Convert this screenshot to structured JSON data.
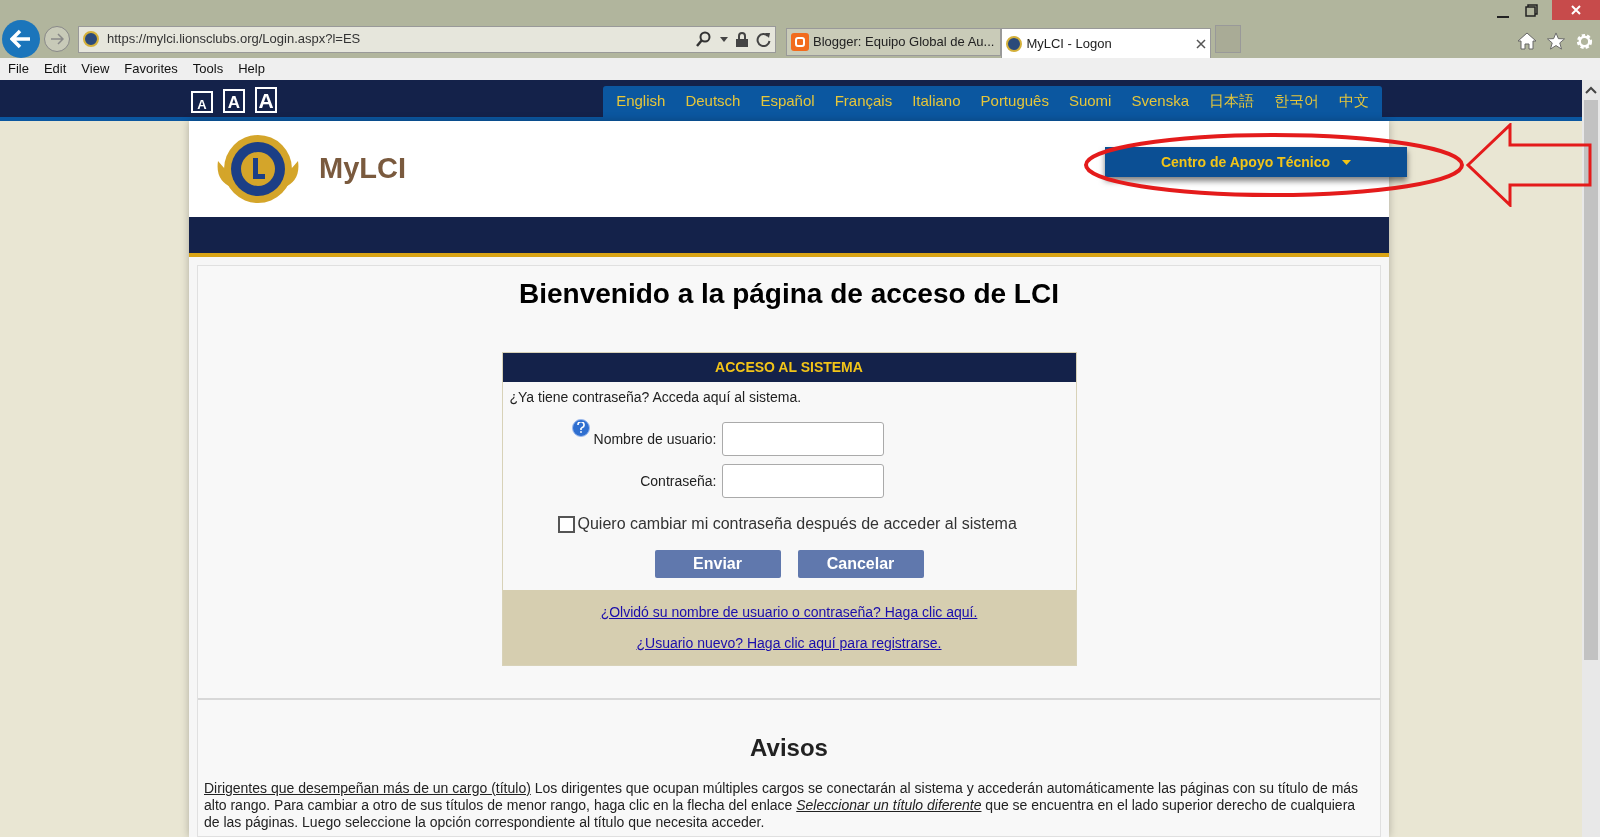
{
  "browser": {
    "address": "https://mylci.lionsclubs.org/Login.aspx?l=ES",
    "tabs": [
      {
        "label": "Blogger: Equipo Global de Au...",
        "selected": false,
        "kind": "blogger"
      },
      {
        "label": "MyLCI - Logon",
        "selected": true,
        "kind": "lions"
      }
    ],
    "menu": [
      "File",
      "Edit",
      "View",
      "Favorites",
      "Tools",
      "Help"
    ]
  },
  "font_size_buttons": [
    "A",
    "A",
    "A"
  ],
  "languages": [
    "English",
    "Deutsch",
    "Español",
    "Français",
    "Italiano",
    "Português",
    "Suomi",
    "Svenska",
    "日本語",
    "한국어",
    "中文"
  ],
  "header": {
    "site_title": "MyLCI",
    "support_menu": "Centro de Apoyo Técnico"
  },
  "page_title": "Bienvenido a la página de acceso de LCI",
  "login": {
    "heading": "ACCESO AL SISTEMA",
    "intro": "¿Ya tiene contraseña? Acceda aquí al sistema.",
    "fields": [
      {
        "label": "Nombre de usuario:",
        "help": true
      },
      {
        "label": "Contraseña:",
        "help": false
      }
    ],
    "change_password": {
      "label": "Quiero cambiar mi contraseña después de acceder al sistema",
      "checked": false
    },
    "buttons": [
      "Enviar",
      "Cancelar"
    ],
    "links": [
      "¿Olvidó su nombre de usuario o contraseña? Haga clic aquí.",
      "¿Usuario nuevo? Haga clic aquí para registrarse."
    ]
  },
  "notices": {
    "title": "Avisos",
    "paragraph": [
      {
        "kind": "link",
        "text": "Dirigentes que desempeñan más de un cargo (título)"
      },
      {
        "kind": "text",
        "text": " Los dirigentes que ocupan múltiples cargos se conectarán al sistema y accederán automáticamente las páginas con su título de más alto rango. Para cambiar a otro de sus títulos de menor rango, haga clic en la flecha del enlace "
      },
      {
        "kind": "italic-link",
        "text": "Seleccionar un título diferente"
      },
      {
        "kind": "text",
        "text": " que se encuentra en el lado superior derecho de cualquiera de las páginas. Luego seleccione la opción correspondiente al título que necesita acceder."
      }
    ]
  }
}
